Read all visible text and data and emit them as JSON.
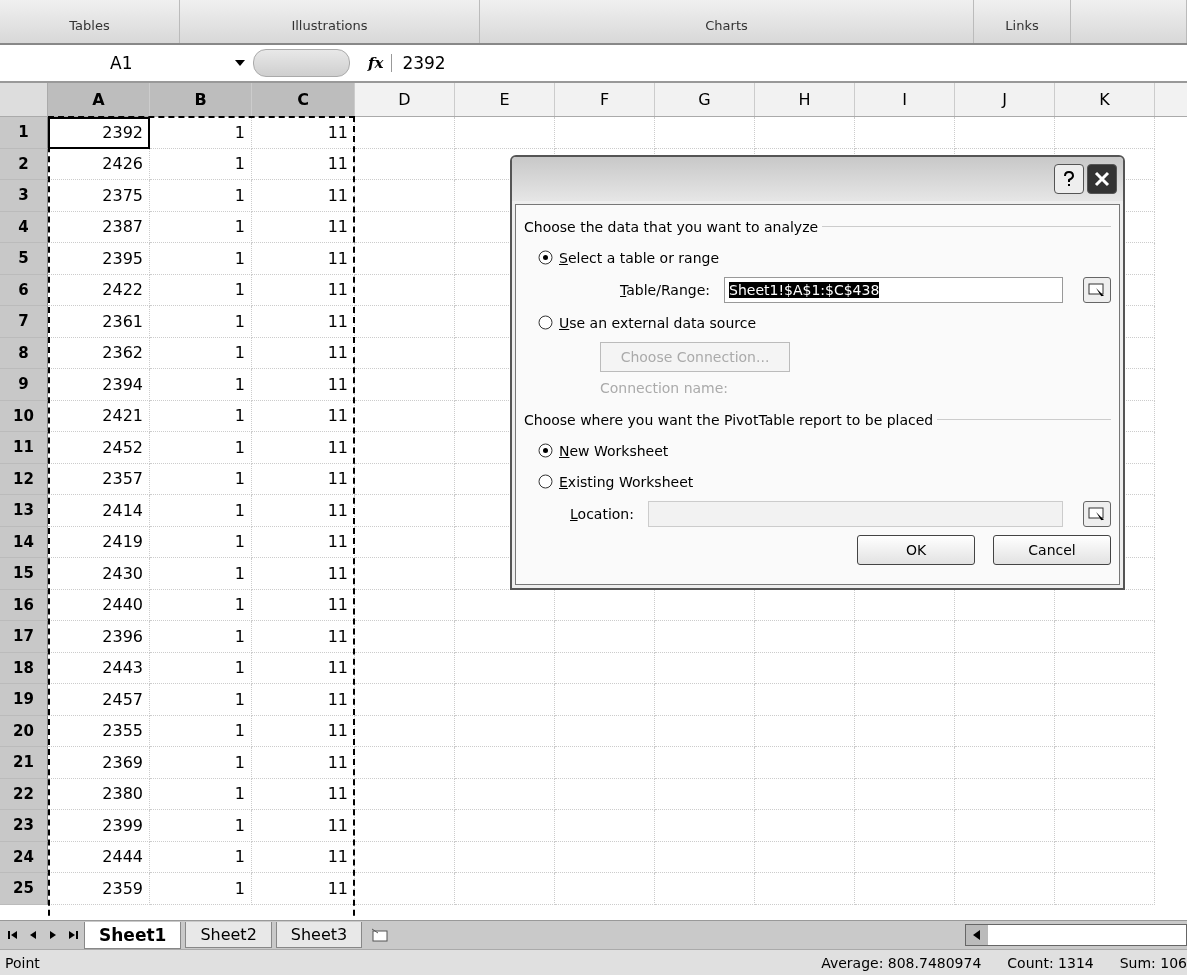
{
  "ribbon_groups": [
    {
      "label": "Tables"
    },
    {
      "label": "Illustrations"
    },
    {
      "label": "Charts"
    },
    {
      "label": "Links"
    }
  ],
  "formula_bar": {
    "name_box": "A1",
    "function_label": "fx",
    "value": "2392"
  },
  "columns": [
    {
      "label": "A",
      "selected": true
    },
    {
      "label": "B",
      "selected": true
    },
    {
      "label": "C",
      "selected": true
    },
    {
      "label": "D",
      "selected": false
    },
    {
      "label": "E",
      "selected": false
    },
    {
      "label": "F",
      "selected": false
    },
    {
      "label": "G",
      "selected": false
    },
    {
      "label": "H",
      "selected": false
    },
    {
      "label": "I",
      "selected": false
    },
    {
      "label": "J",
      "selected": false
    },
    {
      "label": "K",
      "selected": false
    }
  ],
  "rows": [
    {
      "label": "1",
      "selected": true,
      "cells": [
        "2392",
        "1",
        "11"
      ]
    },
    {
      "label": "2",
      "selected": true,
      "cells": [
        "2426",
        "1",
        "11"
      ]
    },
    {
      "label": "3",
      "selected": true,
      "cells": [
        "2375",
        "1",
        "11"
      ]
    },
    {
      "label": "4",
      "selected": true,
      "cells": [
        "2387",
        "1",
        "11"
      ]
    },
    {
      "label": "5",
      "selected": true,
      "cells": [
        "2395",
        "1",
        "11"
      ]
    },
    {
      "label": "6",
      "selected": true,
      "cells": [
        "2422",
        "1",
        "11"
      ]
    },
    {
      "label": "7",
      "selected": true,
      "cells": [
        "2361",
        "1",
        "11"
      ]
    },
    {
      "label": "8",
      "selected": true,
      "cells": [
        "2362",
        "1",
        "11"
      ]
    },
    {
      "label": "9",
      "selected": true,
      "cells": [
        "2394",
        "1",
        "11"
      ]
    },
    {
      "label": "10",
      "selected": true,
      "cells": [
        "2421",
        "1",
        "11"
      ]
    },
    {
      "label": "11",
      "selected": true,
      "cells": [
        "2452",
        "1",
        "11"
      ]
    },
    {
      "label": "12",
      "selected": true,
      "cells": [
        "2357",
        "1",
        "11"
      ]
    },
    {
      "label": "13",
      "selected": true,
      "cells": [
        "2414",
        "1",
        "11"
      ]
    },
    {
      "label": "14",
      "selected": true,
      "cells": [
        "2419",
        "1",
        "11"
      ]
    },
    {
      "label": "15",
      "selected": true,
      "cells": [
        "2430",
        "1",
        "11"
      ]
    },
    {
      "label": "16",
      "selected": true,
      "cells": [
        "2440",
        "1",
        "11"
      ]
    },
    {
      "label": "17",
      "selected": true,
      "cells": [
        "2396",
        "1",
        "11"
      ]
    },
    {
      "label": "18",
      "selected": true,
      "cells": [
        "2443",
        "1",
        "11"
      ]
    },
    {
      "label": "19",
      "selected": true,
      "cells": [
        "2457",
        "1",
        "11"
      ]
    },
    {
      "label": "20",
      "selected": true,
      "cells": [
        "2355",
        "1",
        "11"
      ]
    },
    {
      "label": "21",
      "selected": true,
      "cells": [
        "2369",
        "1",
        "11"
      ]
    },
    {
      "label": "22",
      "selected": true,
      "cells": [
        "2380",
        "1",
        "11"
      ]
    },
    {
      "label": "23",
      "selected": true,
      "cells": [
        "2399",
        "1",
        "11"
      ]
    },
    {
      "label": "24",
      "selected": true,
      "cells": [
        "2444",
        "1",
        "11"
      ]
    },
    {
      "label": "25",
      "selected": true,
      "cells": [
        "2359",
        "1",
        "11"
      ]
    }
  ],
  "dialog": {
    "section_1": "Choose the data that you want to analyze",
    "source_options": [
      {
        "label": "Select a table or range",
        "selected": true
      },
      {
        "label": "Use an external data source",
        "selected": false
      }
    ],
    "table_range": {
      "label": "Table/Range:",
      "value": "Sheet1!$A$1:$C$438"
    },
    "choose_connection": {
      "label": "Choose Connection...",
      "disabled": true
    },
    "connection_name": {
      "label": "Connection name:",
      "disabled": true
    },
    "section_2": "Choose where you want the PivotTable report to be placed",
    "placement_options": [
      {
        "label": "New Worksheet",
        "selected": true
      },
      {
        "label": "Existing Worksheet",
        "selected": false
      }
    ],
    "location": {
      "label": "Location:",
      "disabled": true
    },
    "buttons": [
      "OK",
      "Cancel"
    ]
  },
  "sheet_tabs": [
    {
      "label": "Sheet1",
      "selected": true
    },
    {
      "label": "Sheet2",
      "selected": false
    },
    {
      "label": "Sheet3",
      "selected": false
    }
  ],
  "status_bar": {
    "mode": "Point",
    "stats": [
      "Average: 808.7480974",
      "Count: 1314",
      "Sum: 106"
    ]
  }
}
